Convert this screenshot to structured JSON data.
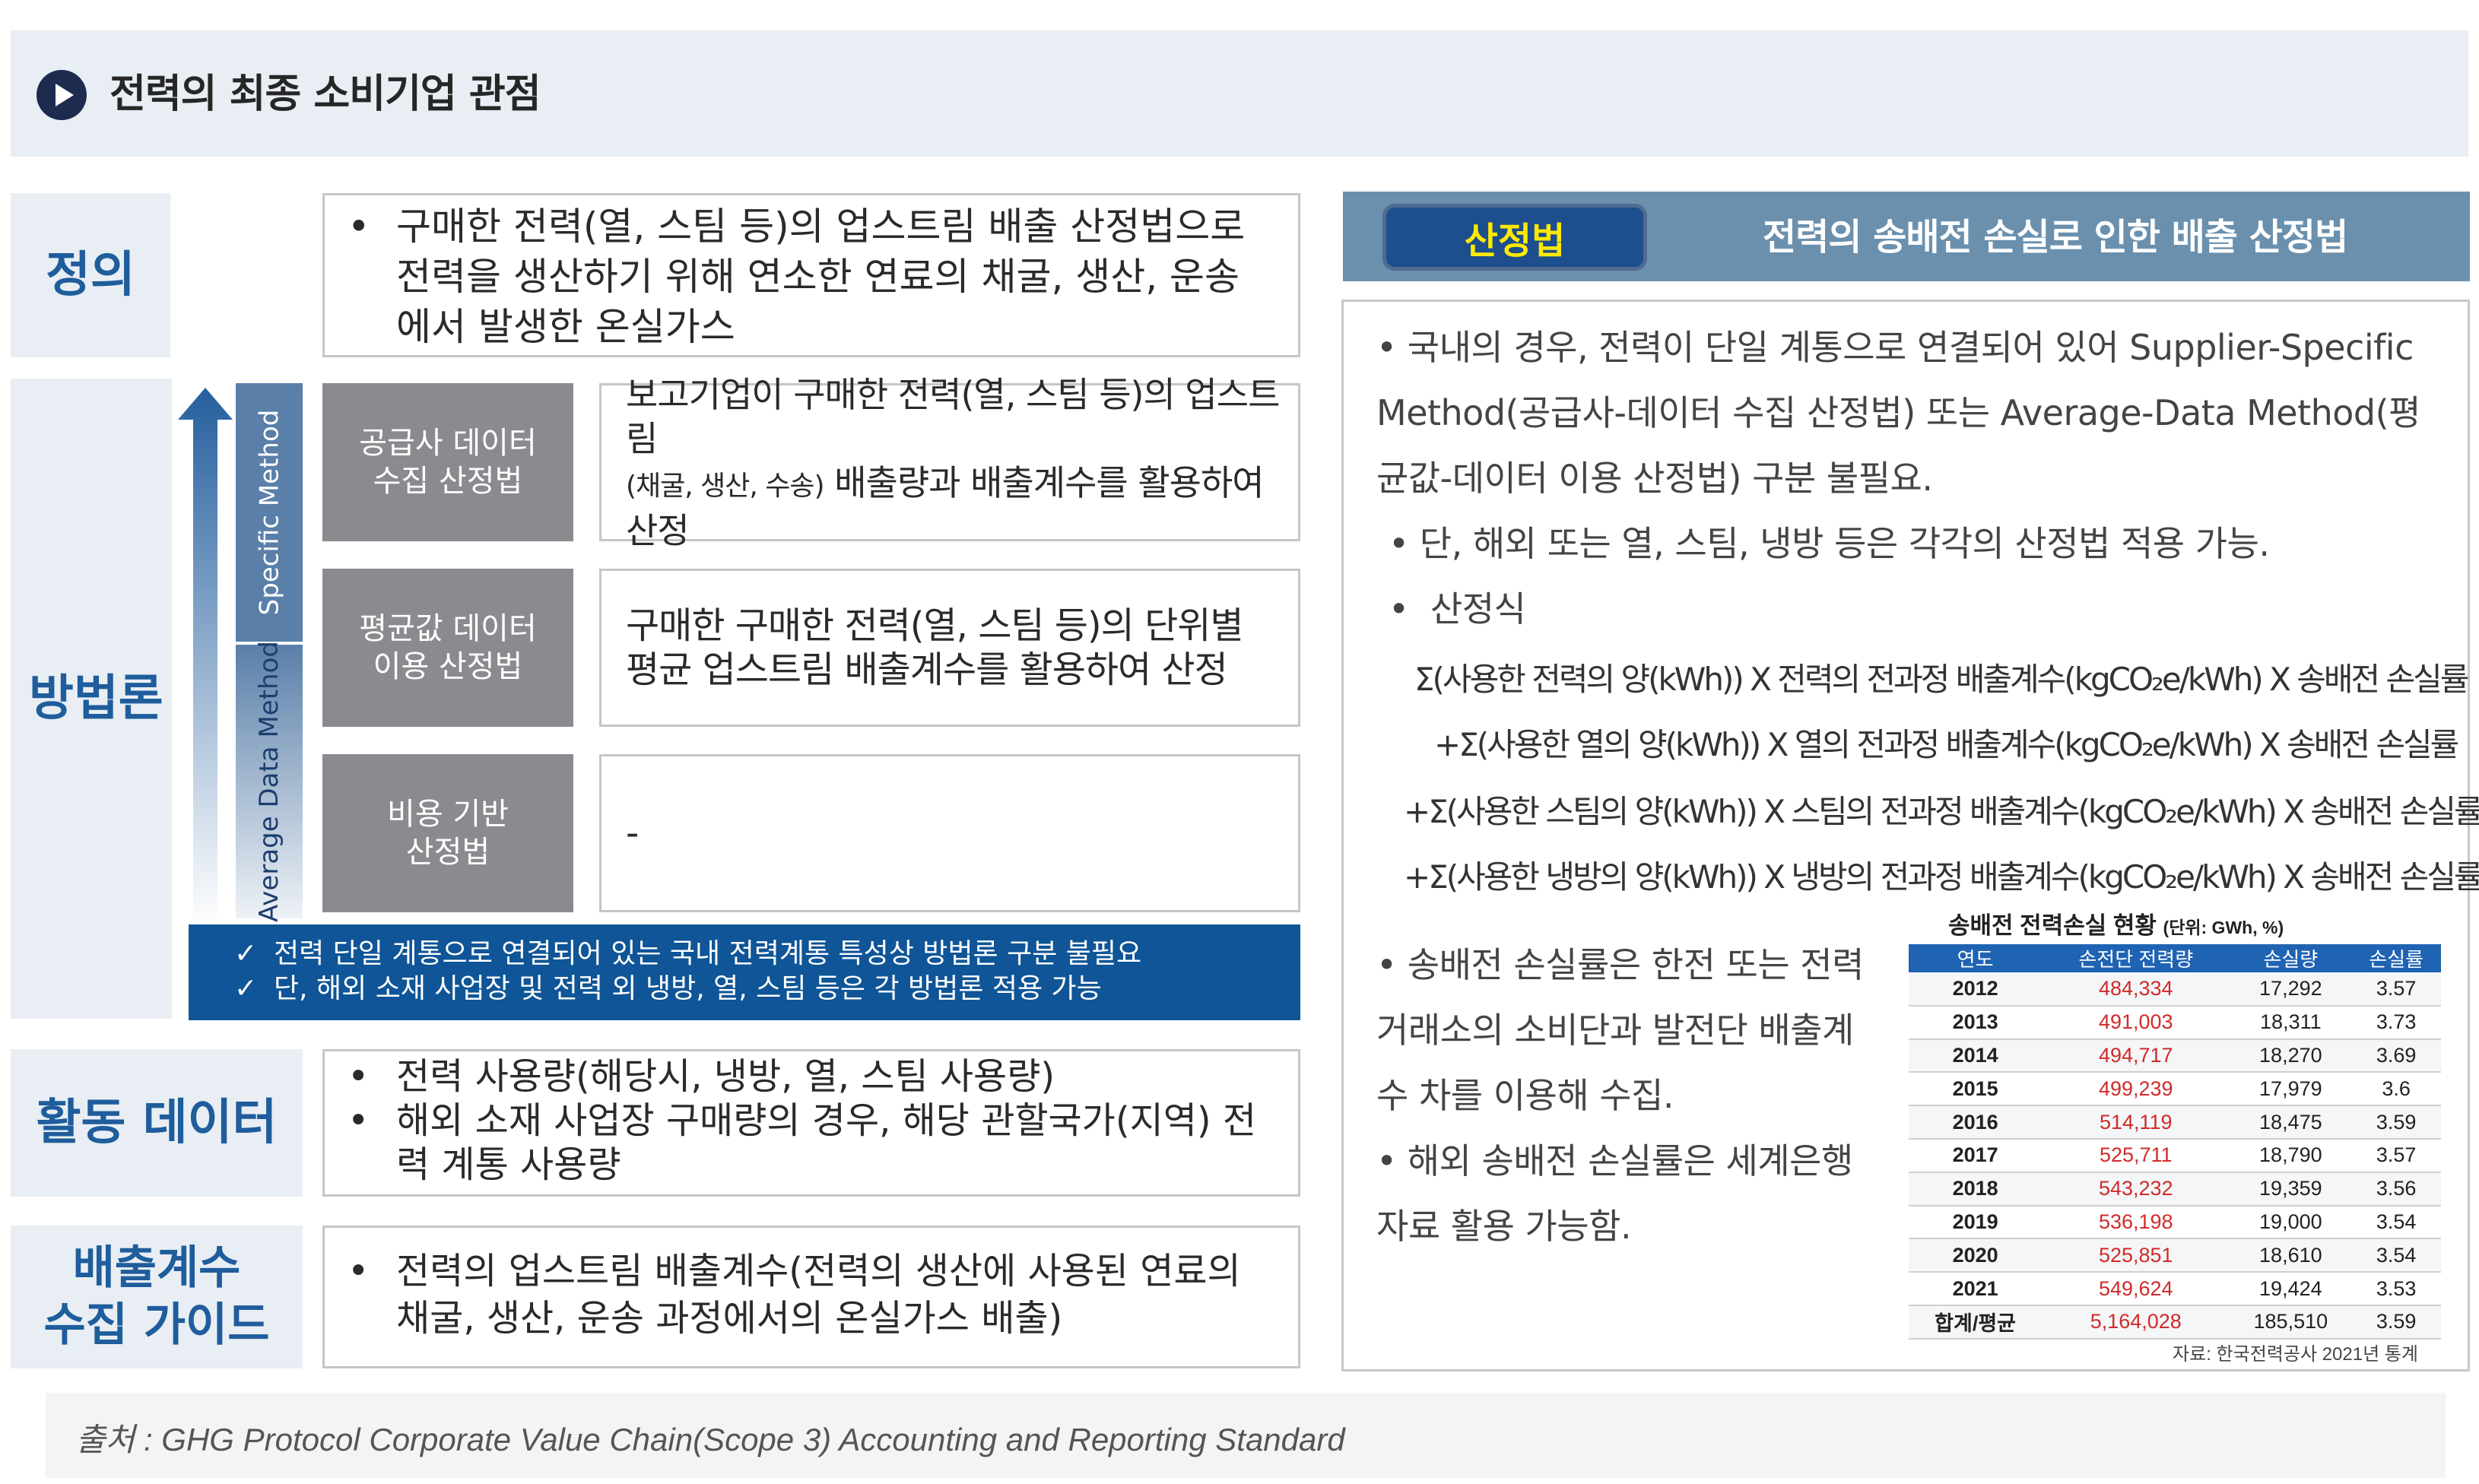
{
  "header": {
    "title": "전력의 최종 소비기업 관점"
  },
  "left": {
    "definition": {
      "label": "정의",
      "text": "구매한 전력(열, 스팀 등)의 업스트림 배출 산정법으로 전력을 생산하기 위해 연소한 연료의 채굴, 생산, 운송에서 발생한 온실가스"
    },
    "methodology": {
      "label": "방법론",
      "specific_tag": "Specific Method",
      "average_tag": "Average Data Method",
      "methods": [
        {
          "name": "공급사 데이터\n수집 산정법",
          "desc_main": "보고기업이 구매한 전력(열, 스팀 등)의 업스트림",
          "desc_sub": "(채굴, 생산, 수송)",
          "desc_rest": " 배출량과 배출계수를 활용하여",
          "desc_end": "산정"
        },
        {
          "name": "평균값 데이터\n이용 산정법",
          "desc": "구매한 구매한 전력(열, 스팀 등)의 단위별\n평균 업스트림 배출계수를 활용하여 산정"
        },
        {
          "name": "비용 기반\n산정법",
          "desc": "-"
        }
      ],
      "notes": [
        "전력 단일 계통으로 연결되어 있는 국내 전력계통 특성상 방법론 구분 불필요",
        "단, 해외 소재 사업장 및 전력 외 냉방, 열, 스팀 등은 각 방법론 적용 가능"
      ]
    },
    "activity": {
      "label": "활동 데이터",
      "items": [
        "전력 사용량(해당시, 냉방, 열, 스팀 사용량)",
        "해외 소재 사업장 구매량의 경우, 해당 관할국가(지역) 전력 계통 사용량"
      ]
    },
    "emission": {
      "label": "배출계수\n수집 가이드",
      "items": [
        "전력의 업스트림 배출계수(전력의 생산에 사용된 연료의 채굴, 생산, 운송 과정에서의 온실가스 배출)"
      ]
    }
  },
  "right": {
    "tag": "산정법",
    "title": "전력의 송배전 손실로 인한 배출 산정법",
    "paragraphs": [
      "국내의 경우, 전력이 단일 계통으로 연결되어 있어 Supplier-Specific Method(공급사-데이터 수집 산정법) 또는 Average-Data Method(평균값-데이터 이용 산정법) 구분 불필요.",
      "단, 해외 또는 열, 스팀, 냉방 등은 각각의 산정법 적용 가능.",
      "산정식"
    ],
    "formulas": [
      "Σ(사용한 전력의 양(kWh)) X 전력의 전과정 배출계수(kgCO₂e/kWh) X 송배전 손실률",
      "+Σ(사용한 열의 양(kWh)) X 열의 전과정 배출계수(kgCO₂e/kWh) X 송배전 손실률",
      "+Σ(사용한 스팀의 양(kWh)) X 스팀의 전과정 배출계수(kgCO₂e/kWh) X 송배전 손실률",
      "+Σ(사용한 냉방의 양(kWh)) X 냉방의 전과정 배출계수(kgCO₂e/kWh) X 송배전 손실률"
    ],
    "bottom_paragraphs": [
      "송배전 손실률은 한전 또는 전력거래소의 소비단과 발전단 배출계수 차를 이용해 수집.",
      "해외 송배전 손실률은 세계은행 자료 활용 가능함."
    ],
    "table": {
      "title": "송배전 전력손실 현황",
      "unit": "(단위: GWh, %)",
      "columns": [
        "연도",
        "손전단 전력량",
        "손실량",
        "손실률"
      ],
      "rows": [
        [
          "2012",
          "484,334",
          "17,292",
          "3.57"
        ],
        [
          "2013",
          "491,003",
          "18,311",
          "3.73"
        ],
        [
          "2014",
          "494,717",
          "18,270",
          "3.69"
        ],
        [
          "2015",
          "499,239",
          "17,979",
          "3.6"
        ],
        [
          "2016",
          "514,119",
          "18,475",
          "3.59"
        ],
        [
          "2017",
          "525,711",
          "18,790",
          "3.57"
        ],
        [
          "2018",
          "543,232",
          "19,359",
          "3.56"
        ],
        [
          "2019",
          "536,198",
          "19,000",
          "3.54"
        ],
        [
          "2020",
          "525,851",
          "18,610",
          "3.54"
        ],
        [
          "2021",
          "549,624",
          "19,424",
          "3.53"
        ],
        [
          "합계/평균",
          "5,164,028",
          "185,510",
          "3.59"
        ]
      ],
      "source": "자료: 한국전력공사 2021년 통계"
    }
  },
  "source": "출처 : GHG Protocol Corporate Value Chain(Scope 3) Accounting and Reporting Standard",
  "colors": {
    "accent": "#1f5d9c",
    "header_bg": "#e8eef3",
    "method_bg": "#8a8b8e",
    "note_bar": "#0f5597",
    "pill_text": "#ffea00",
    "table_red": "#d12a2a"
  }
}
